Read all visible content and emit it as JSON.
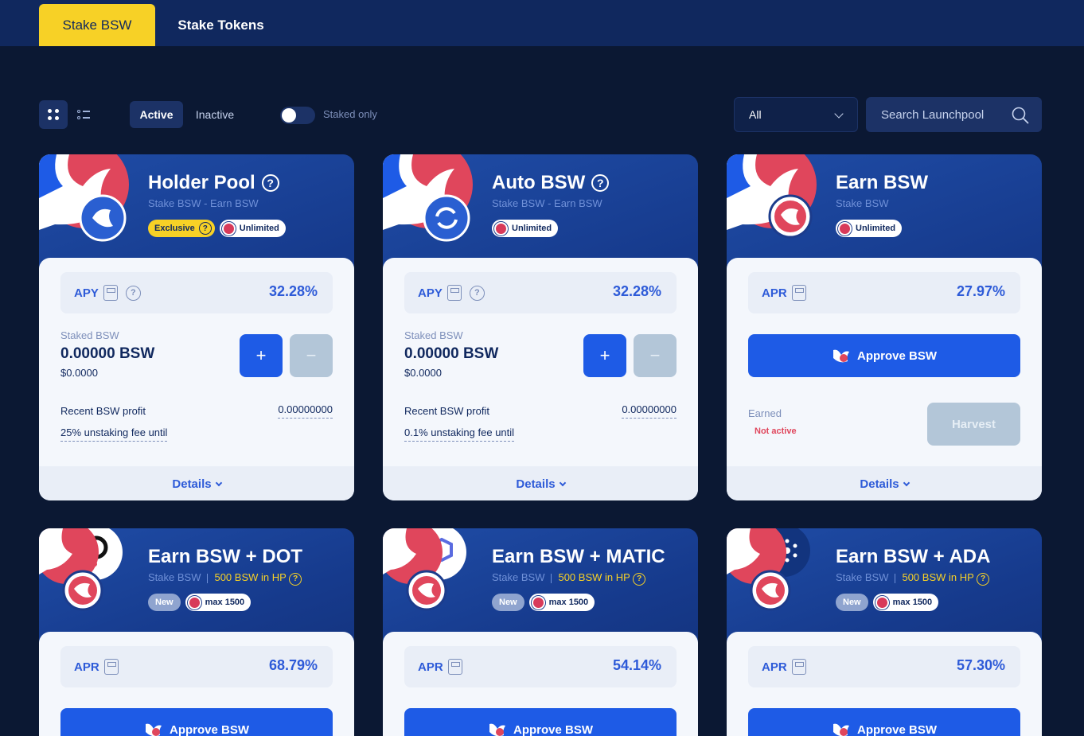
{
  "tabs": {
    "stake_bsw": "Stake BSW",
    "stake_tokens": "Stake Tokens"
  },
  "filters": {
    "active": "Active",
    "inactive": "Inactive",
    "staked_only": "Staked only",
    "select_value": "All",
    "search_placeholder": "Search Launchpool"
  },
  "common": {
    "apy": "APY",
    "apr": "APR",
    "staked_label": "Staked BSW",
    "staked_amount": "0.00000 BSW",
    "staked_usd": "$0.0000",
    "profit_label": "Recent BSW profit",
    "profit_value": "0.00000000",
    "details": "Details",
    "plus": "+",
    "minus": "−",
    "approve": "Approve BSW",
    "earned": "Earned",
    "not_active": "Not active",
    "harvest": "Harvest",
    "unlimited": "Unlimited",
    "exclusive": "Exclusive",
    "new": "New",
    "max": "max 1500",
    "hp": "500 BSW in HP",
    "q": "?"
  },
  "cards": [
    {
      "title": "Holder Pool",
      "subtitle": "Stake BSW - Earn BSW",
      "rate": "32.28%",
      "fee": "25% unstaking fee until"
    },
    {
      "title": "Auto BSW",
      "subtitle": "Stake BSW - Earn BSW",
      "rate": "32.28%",
      "fee": "0.1% unstaking fee until"
    },
    {
      "title": "Earn BSW",
      "subtitle": "Stake BSW",
      "rate": "27.97%"
    },
    {
      "title": "Earn BSW + DOT",
      "subtitle": "Stake BSW",
      "rate": "68.79%"
    },
    {
      "title": "Earn BSW + MATIC",
      "subtitle": "Stake BSW",
      "rate": "54.14%"
    },
    {
      "title": "Earn BSW + ADA",
      "subtitle": "Stake BSW",
      "rate": "57.30%"
    }
  ],
  "colors": {
    "brand_blue": "#1e5be6",
    "accent_yellow": "#f7d126",
    "background": "#0b1833",
    "danger": "#e0465c"
  }
}
